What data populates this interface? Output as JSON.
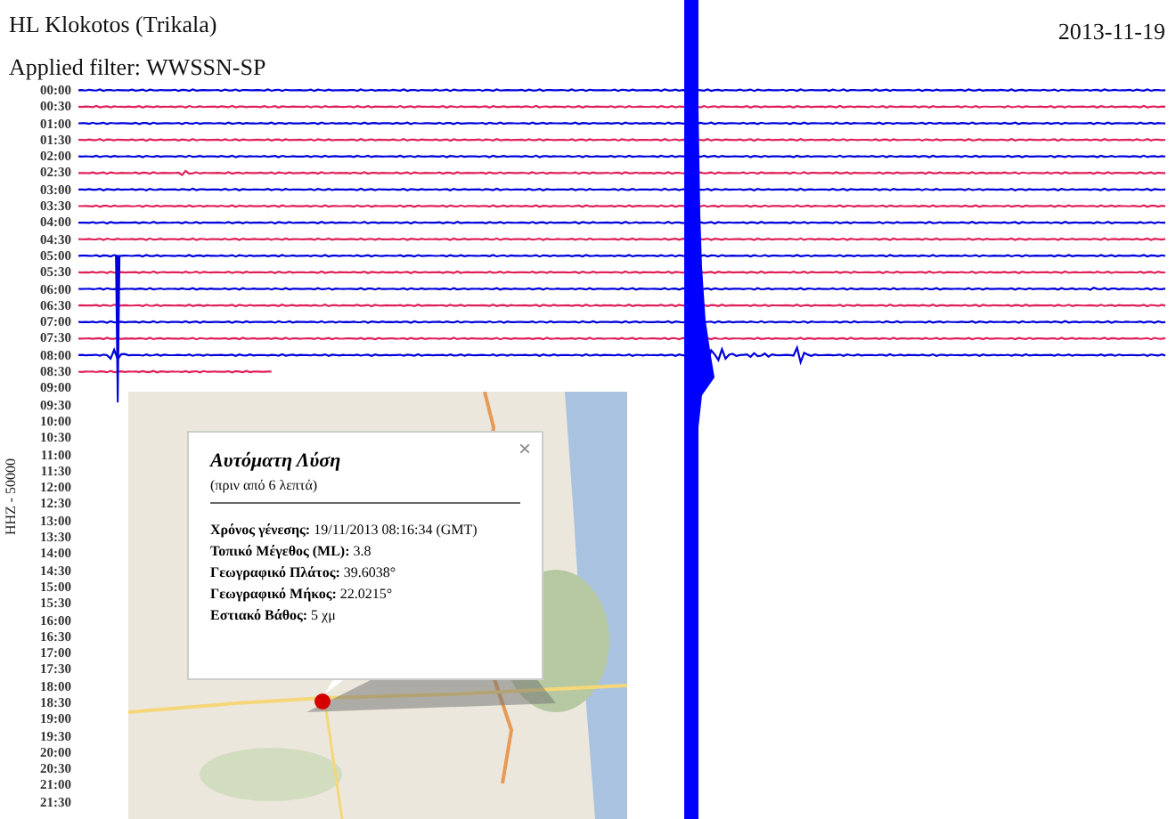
{
  "header": {
    "station": "HL Klokotos (Trikala)",
    "filter": "Applied filter: WWSSN-SP",
    "date": "2013-11-19"
  },
  "channel_label": "HHZ - 50000",
  "time_labels": [
    "00:00",
    "00:30",
    "01:00",
    "01:30",
    "02:00",
    "02:30",
    "03:00",
    "03:30",
    "04:00",
    "04:30",
    "05:00",
    "05:30",
    "06:00",
    "06:30",
    "07:00",
    "07:30",
    "08:00",
    "08:30",
    "09:00",
    "09:30",
    "10:00",
    "10:30",
    "11:00",
    "11:30",
    "12:00",
    "12:30",
    "13:00",
    "13:30",
    "14:00",
    "14:30",
    "15:00",
    "15:30",
    "16:00",
    "16:30",
    "17:00",
    "17:30",
    "18:00",
    "18:30",
    "19:00",
    "19:30",
    "20:00",
    "20:30",
    "21:00",
    "21:30"
  ],
  "traces": [
    {
      "color": "#0000dd"
    },
    {
      "color": "#e0205a"
    },
    {
      "color": "#0000dd"
    },
    {
      "color": "#e0205a"
    },
    {
      "color": "#0000dd"
    },
    {
      "color": "#e0205a"
    },
    {
      "color": "#0000dd"
    },
    {
      "color": "#e0205a"
    },
    {
      "color": "#0000dd"
    },
    {
      "color": "#e0205a"
    },
    {
      "color": "#0000dd"
    },
    {
      "color": "#e0205a"
    },
    {
      "color": "#0000dd"
    },
    {
      "color": "#e0205a"
    },
    {
      "color": "#0000dd"
    },
    {
      "color": "#e0205a"
    },
    {
      "color": "#0000dd"
    },
    {
      "color": "#e0205a"
    }
  ],
  "popup": {
    "title": "Αυτόματη Λύση",
    "subtitle": "(πριν από 6 λεπτά)",
    "close": "×",
    "lines": [
      "**Χρόνος γένεσης:** 19/11/2013  08:16:34 (GMT)",
      "**Τοπικό Μέγεθος (ML):** 3.8",
      "**Γεωγραφικό Πλάτος:** 39.6038°",
      "**Γεωγραφικό Μήκος:** 22.0215°",
      "**Εστιακό Βάθος:** 5 χμ"
    ]
  }
}
